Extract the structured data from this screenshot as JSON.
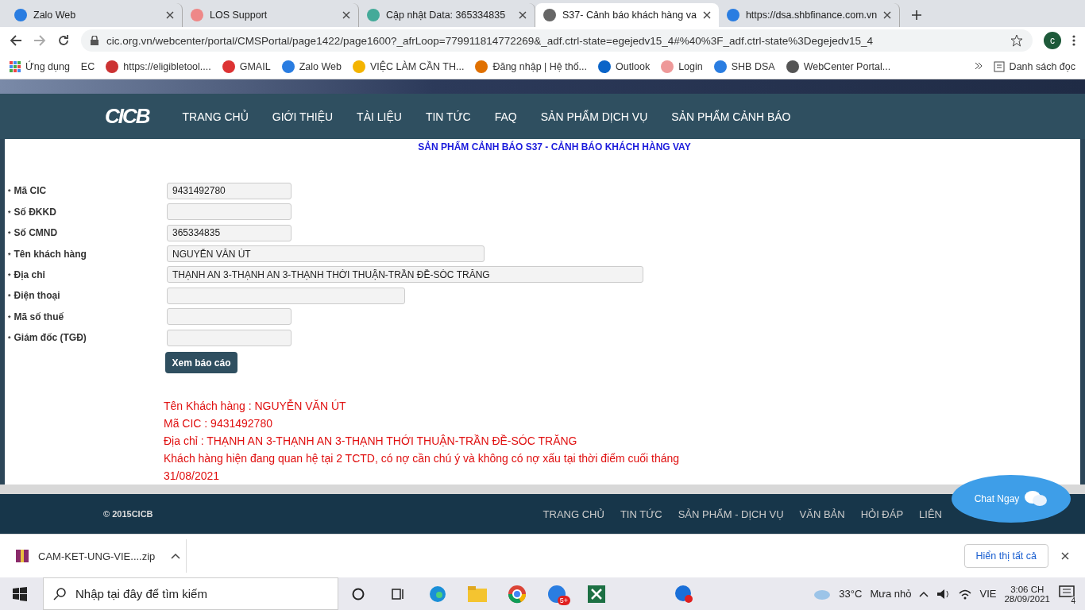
{
  "tabs": [
    {
      "title": "Zalo Web",
      "selected": false
    },
    {
      "title": "LOS Support",
      "selected": false
    },
    {
      "title": "Cập nhật Data: 365334835",
      "selected": false
    },
    {
      "title": "S37- Cảnh báo khách hàng va",
      "selected": true
    },
    {
      "title": "https://dsa.shbfinance.com.vn",
      "selected": false
    }
  ],
  "address": "cic.org.vn/webcenter/portal/CMSPortal/page1422/page1600?_afrLoop=779911814772269&_adf.ctrl-state=egejedv15_4#%40%3F_adf.ctrl-state%3Degejedv15_4",
  "profile": "c",
  "apps_label": "Ứng dụng",
  "bookmarks": [
    {
      "label": "EC"
    },
    {
      "label": "https://eligibletool...."
    },
    {
      "label": "GMAIL"
    },
    {
      "label": "Zalo Web"
    },
    {
      "label": "VIỆC LÀM CẦN TH..."
    },
    {
      "label": "Đăng nhập | Hệ thố..."
    },
    {
      "label": "Outlook"
    },
    {
      "label": "Login"
    },
    {
      "label": "SHB DSA"
    },
    {
      "label": "WebCenter Portal..."
    }
  ],
  "reading_list": "Danh sách đọc",
  "logo": "CICB",
  "nav": [
    "TRANG CHỦ",
    "GIỚI THIỆU",
    "TÀI LIỆU",
    "TIN TỨC",
    "FAQ",
    "SẢN PHẨM DỊCH VỤ",
    "SẢN PHẨM CẢNH BÁO"
  ],
  "page_title": "SẢN PHẨM CẢNH BÁO S37 - CẢNH BÁO KHÁCH HÀNG VAY",
  "fields": [
    {
      "marker": "*",
      "label": "Mã CIC",
      "value": "9431492780",
      "kind": "short"
    },
    {
      "marker": "*",
      "label": "Số ĐKKD",
      "kind": "short"
    },
    {
      "marker": "*",
      "label": "Số CMND",
      "value": "365334835",
      "kind": "short"
    },
    {
      "marker": "*",
      "label": "Tên khách hàng",
      "value": "NGUYỄN VĂN ÚT",
      "kind": "long"
    },
    {
      "marker": "*",
      "label": "Địa chỉ",
      "value": "THẠNH AN 3-THẠNH AN 3-THẠNH THỚI THUẬN-TRẦN ĐỀ-SÓC TRĂNG",
      "kind": "xlong"
    },
    {
      "marker": "*",
      "label": "Điện thoại",
      "kind": "medium"
    },
    {
      "marker": "*",
      "label": "Mã số thuế",
      "kind": "short"
    },
    {
      "marker": "*",
      "label": "Giám đốc (TGĐ)",
      "kind": "short"
    }
  ],
  "submit": "Xem báo cáo",
  "result": [
    "Tên Khách hàng : NGUYỄN VĂN ÚT",
    "Mã CIC : 9431492780",
    "Địa chỉ : THẠNH AN 3-THẠNH AN 3-THẠNH THỚI THUẬN-TRẦN ĐỀ-SÓC TRĂNG",
    "Khách hàng hiện đang quan hệ tại 2 TCTD, có nợ cần chú ý và không có nợ xấu tại thời điểm cuối tháng 31/08/2021"
  ],
  "footer": {
    "copyright": "© 2015CICB",
    "links": [
      "TRANG CHỦ",
      "TIN TỨC",
      "SẢN PHẨM - DỊCH VỤ",
      "VĂN BẢN",
      "HỎI ĐÁP",
      "LIÊN"
    ]
  },
  "chat": "Chat Ngay",
  "download": {
    "file": "CAM-KET-UNG-VIE....zip",
    "show_all": "Hiển thị tất cả"
  },
  "taskbar": {
    "search_placeholder": "Nhập tại đây để tìm kiếm",
    "zalo_badge": "5+",
    "temperature": "33°C",
    "weather": "Mưa nhỏ",
    "language": "VIE",
    "time": "3:06 CH",
    "date": "28/09/2021",
    "notifications": "4"
  }
}
